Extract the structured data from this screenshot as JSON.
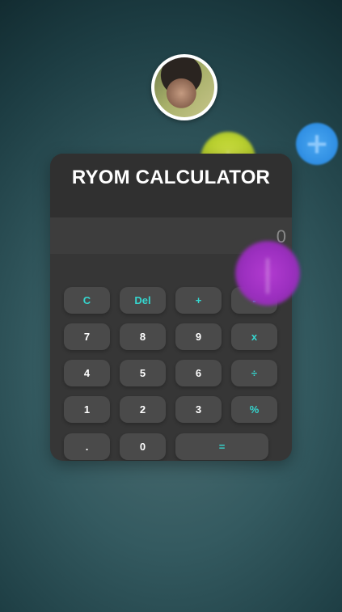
{
  "app": {
    "title": "RYOM CALCULATOR"
  },
  "display": {
    "value": "0"
  },
  "keys": {
    "row1": [
      "C",
      "Del",
      "+",
      "-"
    ],
    "row2": [
      "7",
      "8",
      "9",
      "x"
    ],
    "row3": [
      "4",
      "5",
      "6",
      "÷"
    ],
    "row4": [
      "1",
      "2",
      "3",
      "%"
    ],
    "row5": [
      ".",
      "0",
      "="
    ]
  },
  "decor": {
    "yellow_mark": "+",
    "blue_mark": "+",
    "purple_mark": "|"
  },
  "colors": {
    "accent": "#35d6cf",
    "card": "#363636",
    "key": "#4a4a4a"
  },
  "icons": [
    "avatar-photo",
    "plus-icon",
    "divide-icon",
    "minus-icon"
  ]
}
